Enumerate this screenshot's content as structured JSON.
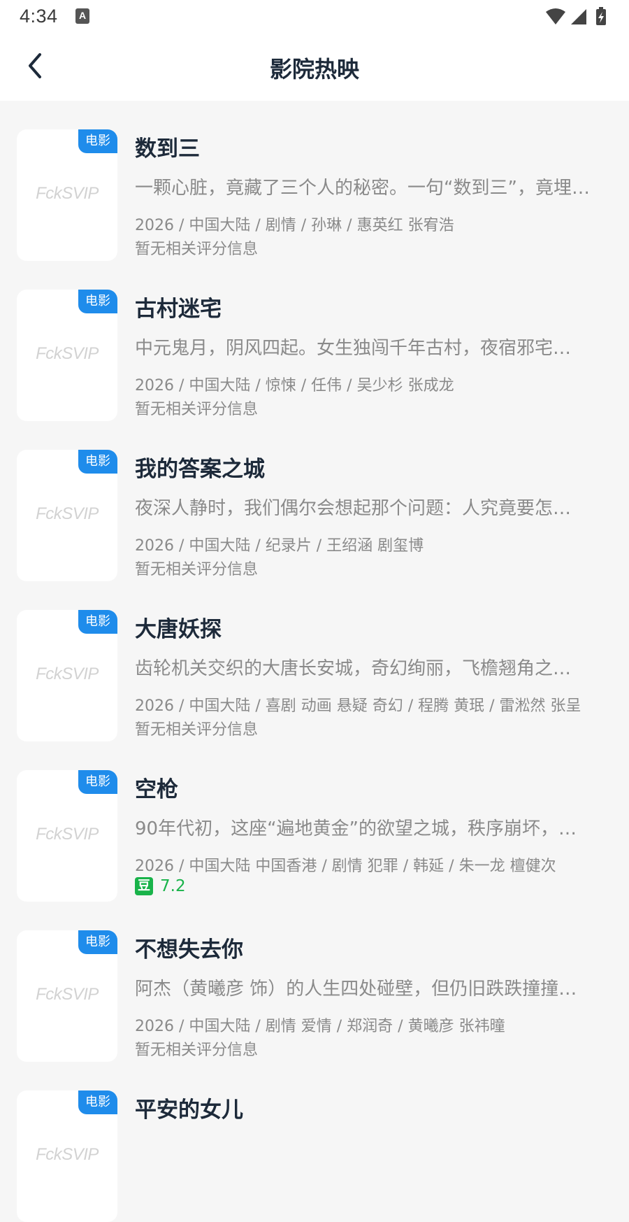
{
  "status_bar": {
    "time": "4:34",
    "notification_icon": "A"
  },
  "header": {
    "title": "影院热映"
  },
  "movies": [
    {
      "badge": "电影",
      "poster_text": "FckSVIP",
      "title": "数到三",
      "desc": "一颗心脏，竟藏了三个人的秘密。一句“数到三”，竟埋…",
      "meta": "2026 / 中国大陆 / 剧情 / 孙琳 / 惠英红 张宥浩",
      "rating_text": "暂无相关评分信息",
      "has_score": false
    },
    {
      "badge": "电影",
      "poster_text": "FckSVIP",
      "title": "古村迷宅",
      "desc": "中元鬼月，阴风四起。女生独闯千年古村，夜宿邪宅…",
      "meta": "2026 / 中国大陆 / 惊悚 / 任伟 / 吴少杉 张成龙",
      "rating_text": "暂无相关评分信息",
      "has_score": false
    },
    {
      "badge": "电影",
      "poster_text": "FckSVIP",
      "title": "我的答案之城",
      "desc": "夜深人静时，我们偶尔会想起那个问题：人究竟要怎…",
      "meta": "2026 / 中国大陆 / 纪录片 / 王绍涵 剧玺博",
      "rating_text": "暂无相关评分信息",
      "has_score": false
    },
    {
      "badge": "电影",
      "poster_text": "FckSVIP",
      "title": "大唐妖探",
      "desc": "齿轮机关交织的大唐长安城，奇幻绚丽，飞檐翘角之…",
      "meta": "2026 / 中国大陆 / 喜剧 动画 悬疑 奇幻 / 程腾 黄珉 / 雷淞然 张呈",
      "rating_text": "暂无相关评分信息",
      "has_score": false
    },
    {
      "badge": "电影",
      "poster_text": "FckSVIP",
      "title": "空枪",
      "desc": "90年代初，这座“遍地黄金”的欲望之城，秩序崩坏，…",
      "meta": "2026 / 中国大陆 中国香港 / 剧情 犯罪 / 韩延 / 朱一龙 檀健次",
      "rating_icon": "豆",
      "rating_text": "7.2",
      "has_score": true
    },
    {
      "badge": "电影",
      "poster_text": "FckSVIP",
      "title": "不想失去你",
      "desc": "阿杰（黄曦彦 饰）的人生四处碰壁，但仍旧跌跌撞撞…",
      "meta": "2026 / 中国大陆 / 剧情 爱情 / 郑润奇 / 黄曦彦 张祎曈",
      "rating_text": "暂无相关评分信息",
      "has_score": false
    },
    {
      "badge": "电影",
      "poster_text": "FckSVIP",
      "title": "平安的女儿",
      "desc": "",
      "meta": "",
      "rating_text": "",
      "has_score": false
    }
  ],
  "colors": {
    "accent": "#1f8ceb",
    "score_green": "#19b34a",
    "text_primary": "#1d2a3a",
    "text_secondary": "#8a8a8a",
    "background": "#f6f6f6"
  }
}
